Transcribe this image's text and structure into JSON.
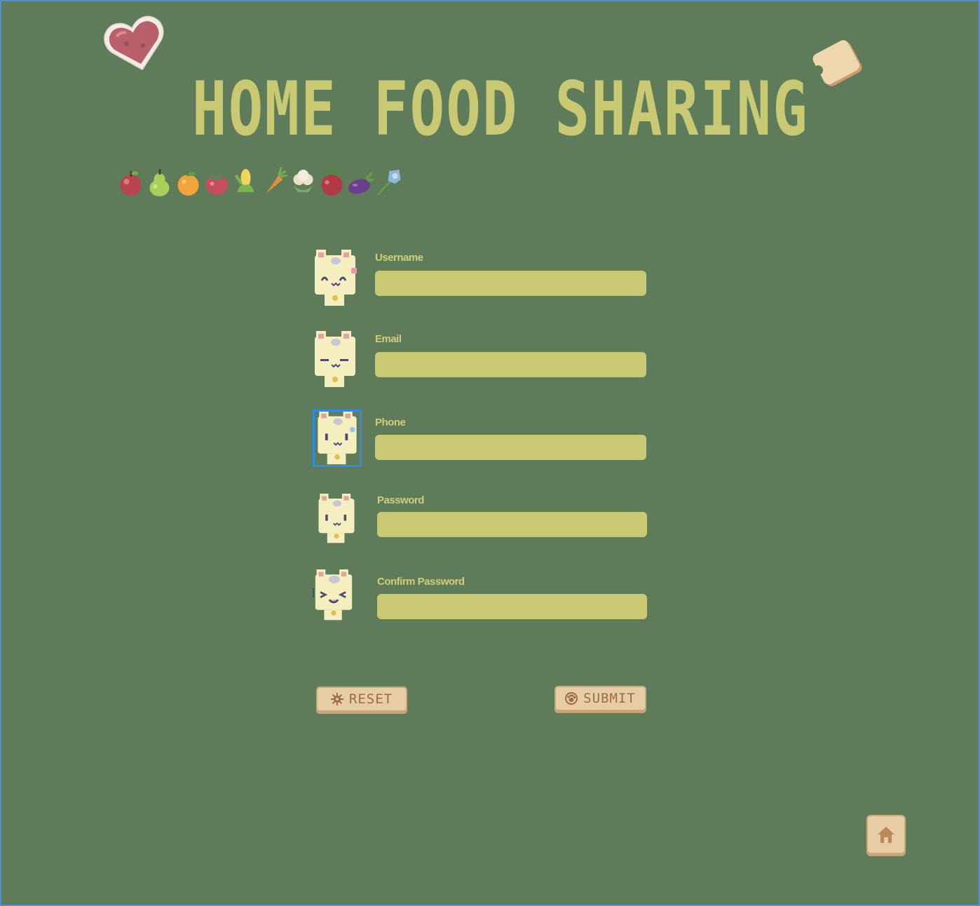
{
  "header": {
    "title": "HOME FOOD SHARING"
  },
  "stickers": [
    "heart-sticker",
    "toast-sticker"
  ],
  "produce_icons": [
    "apple-icon",
    "pear-icon",
    "orange-icon",
    "tomato-icon",
    "corn-icon",
    "carrot-icon",
    "cauliflower-icon",
    "beet-icon",
    "eggplant-icon",
    "bellflower-icon"
  ],
  "form": {
    "fields": [
      {
        "label": "Username",
        "value": "",
        "icon": "cat-happy-icon"
      },
      {
        "label": "Email",
        "value": "",
        "icon": "cat-sleepy-icon"
      },
      {
        "label": "Phone",
        "value": "",
        "icon": "cat-sweat-icon"
      },
      {
        "label": "Password",
        "value": "",
        "icon": "cat-neutral-icon"
      },
      {
        "label": "Confirm Password",
        "value": "",
        "icon": "cat-excited-icon"
      }
    ],
    "reset_label": "RESET",
    "submit_label": "SUBMIT"
  },
  "colors": {
    "background": "#5e7c5a",
    "title": "#c9c973",
    "input": "#c9c973",
    "label": "#d2cd79",
    "button_bg": "#e7cda4",
    "button_text": "#9b6b45",
    "focus": "#2f8ae8"
  }
}
